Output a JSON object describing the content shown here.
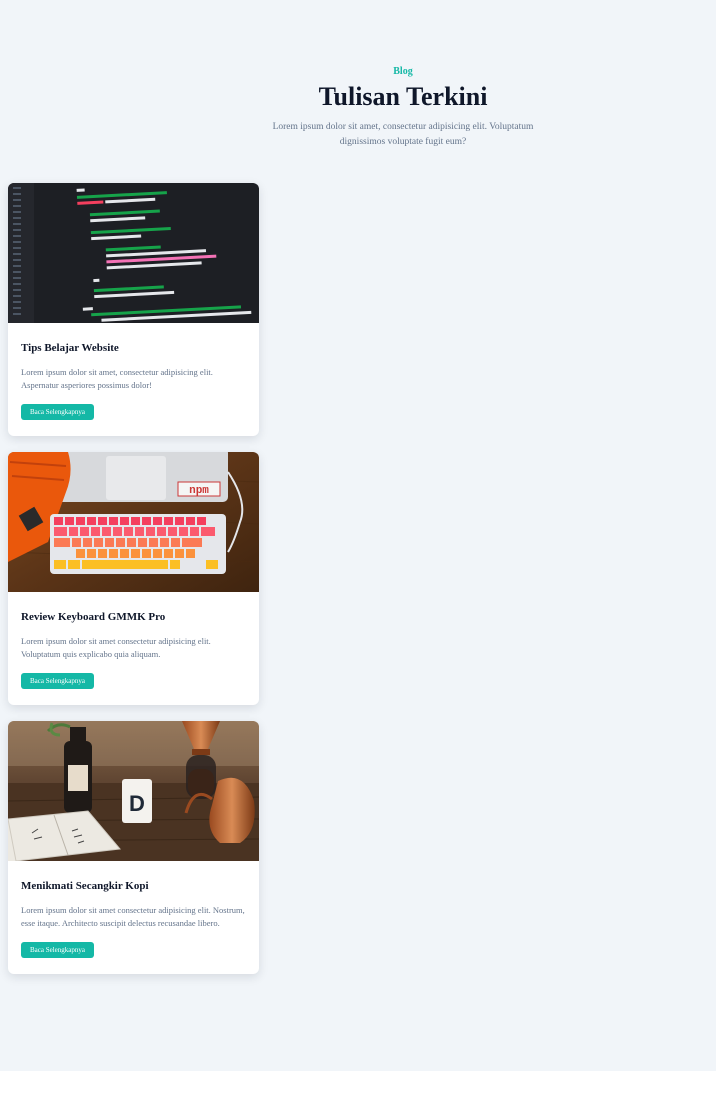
{
  "header": {
    "eyebrow": "Blog",
    "title": "Tulisan Terkini",
    "subtitle": "Lorem ipsum dolor sit amet, consectetur adipisicing elit. Voluptatum dignissimos voluptate fugit eum?"
  },
  "posts": [
    {
      "title": "Tips Belajar Website",
      "excerpt": "Lorem ipsum dolor sit amet, consectetur adipisicing elit. Aspernatur asperiores possimus dolor!",
      "button": "Baca Selengkapnya",
      "image": "code-editor-photo"
    },
    {
      "title": "Review Keyboard GMMK Pro",
      "excerpt": "Lorem ipsum dolor sit amet consectetur adipisicing elit. Voluptatum quis explicabo quia aliquam.",
      "button": "Baca Selengkapnya",
      "image": "keyboard-photo",
      "image_text": "npm"
    },
    {
      "title": "Menikmati Secangkir Kopi",
      "excerpt": "Lorem ipsum dolor sit amet consectetur adipisicing elit. Nostrum, esse itaque. Architecto suscipit delectus recusandae libero.",
      "button": "Baca Selengkapnya",
      "image": "coffee-photo",
      "image_text": "D"
    }
  ],
  "colors": {
    "accent": "#14b8a6",
    "background": "#f1f5f9",
    "heading": "#0f172a",
    "text": "#64748b"
  }
}
